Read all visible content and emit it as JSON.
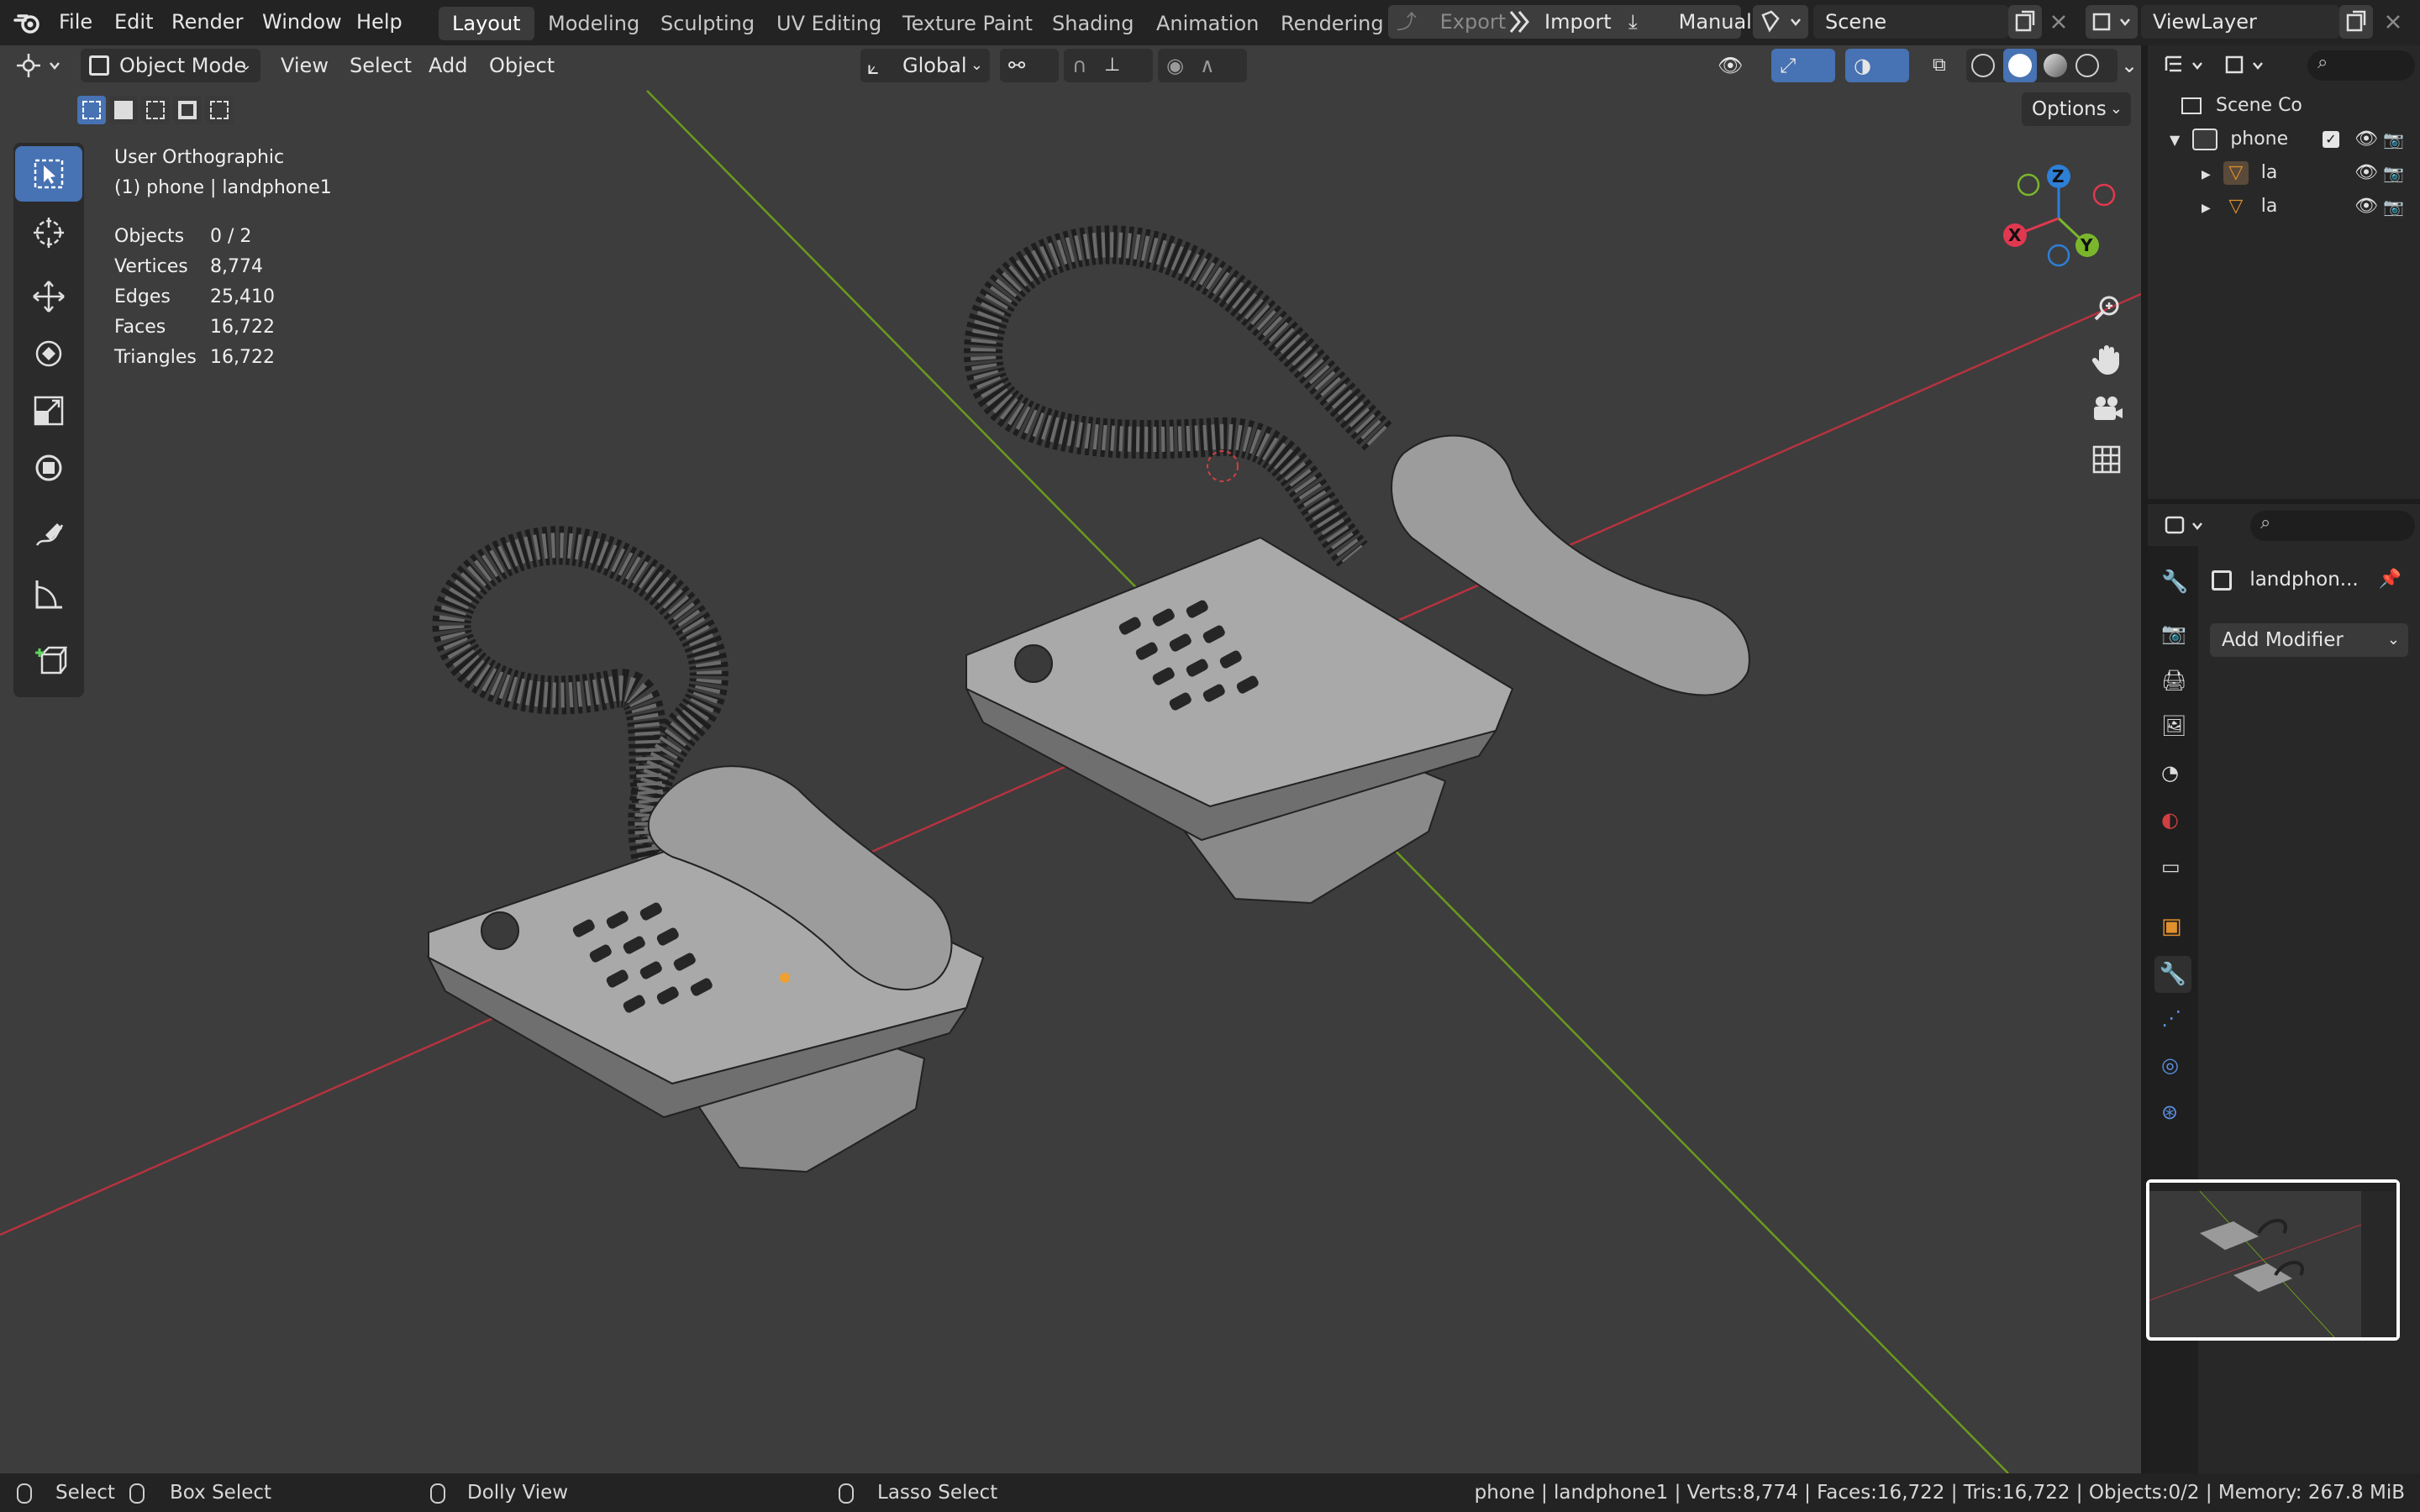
{
  "topbar": {
    "menu": [
      "File",
      "Edit",
      "Render",
      "Window",
      "Help"
    ],
    "workspaces": [
      "Layout",
      "Modeling",
      "Sculpting",
      "UV Editing",
      "Texture Paint",
      "Shading",
      "Animation",
      "Rendering"
    ],
    "active_workspace": "Layout",
    "export_label": "Export",
    "import_label": "Import",
    "manual_label": "Manual",
    "scene_name": "Scene",
    "view_layer": "ViewLayer"
  },
  "viewport_header": {
    "mode": "Object Mode",
    "menus": [
      "View",
      "Select",
      "Add",
      "Object"
    ],
    "orientation": "Global",
    "options_label": "Options"
  },
  "viewport_overlay": {
    "view_name": "User Orthographic",
    "active_object": "(1) phone | landphone1",
    "stats": [
      {
        "label": "Objects",
        "value": "0 / 2"
      },
      {
        "label": "Vertices",
        "value": "8,774"
      },
      {
        "label": "Edges",
        "value": "25,410"
      },
      {
        "label": "Faces",
        "value": "16,722"
      },
      {
        "label": "Triangles",
        "value": "16,722"
      }
    ]
  },
  "gizmo": {
    "axes": [
      "Z",
      "Y",
      "X"
    ],
    "colors": {
      "x": "#e0384f",
      "y": "#7ab62c",
      "z": "#2e7fd6"
    }
  },
  "outliner": {
    "root": "Scene Co",
    "collection": "phone",
    "items": [
      "la",
      "la"
    ]
  },
  "properties": {
    "object_name": "landphon...",
    "add_modifier": "Add Modifier"
  },
  "statusbar": {
    "select": "Select",
    "box_select": "Box Select",
    "dolly": "Dolly View",
    "lasso": "Lasso Select",
    "info": "phone | landphone1 | Verts:8,774 | Faces:16,722 | Tris:16,722 | Objects:0/2 | Memory: 267.8 MiB"
  },
  "colors": {
    "accent": "#4772b3",
    "viewport_bg": "#3d3d3d",
    "x_axis": "#b5333f",
    "y_axis": "#6a9a1e"
  }
}
